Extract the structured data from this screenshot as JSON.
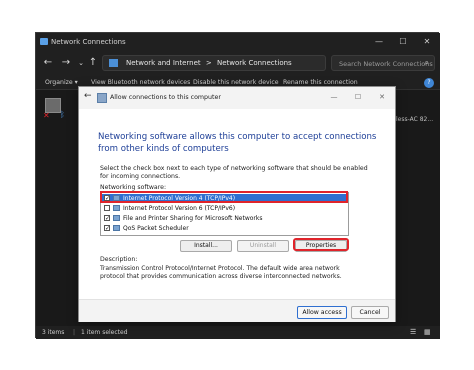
{
  "explorer": {
    "title": "Network Connections",
    "address": [
      "Network and Internet",
      ">",
      "Network Connections"
    ],
    "search_placeholder": "Search Network Connections",
    "commands": [
      "Organize ▾",
      "View Bluetooth network devices",
      "Disable this network device",
      "Rename this connection"
    ],
    "help": "?",
    "partial_item_text": "less-AC 82...",
    "status": {
      "items": "3 items",
      "selected": "1 item selected"
    },
    "icons": [
      "back-arrow-icon",
      "forward-arrow-icon",
      "dropdown-chevron-icon",
      "up-arrow-icon",
      "search-icon",
      "minimize-icon",
      "maximize-icon",
      "close-icon",
      "list-view-icon",
      "tiles-view-icon"
    ]
  },
  "dialog": {
    "title": "Allow connections to this computer",
    "heading": "Networking software allows this computer to accept connections from other kinds of computers",
    "instructions": "Select the check box next to each type of networking software that should be enabled for incoming connections.",
    "software_label": "Networking software:",
    "items": [
      {
        "label": "Internet Protocol Version 4 (TCP/IPv4)",
        "checked": true,
        "selected": true
      },
      {
        "label": "Internet Protocol Version 6 (TCP/IPv6)",
        "checked": false,
        "selected": false
      },
      {
        "label": "File and Printer Sharing for Microsoft Networks",
        "checked": true,
        "selected": false
      },
      {
        "label": "QoS Packet Scheduler",
        "checked": true,
        "selected": false
      }
    ],
    "buttons": {
      "install": "Install...",
      "uninstall": "Uninstall",
      "properties": "Properties"
    },
    "description_label": "Description:",
    "description": "Transmission Control Protocol/Internet Protocol. The default wide area network protocol that provides communication across diverse interconnected networks.",
    "allow": "Allow access",
    "cancel": "Cancel",
    "highlight_color": "#e0242b",
    "selection_color": "#2f6fd0"
  }
}
